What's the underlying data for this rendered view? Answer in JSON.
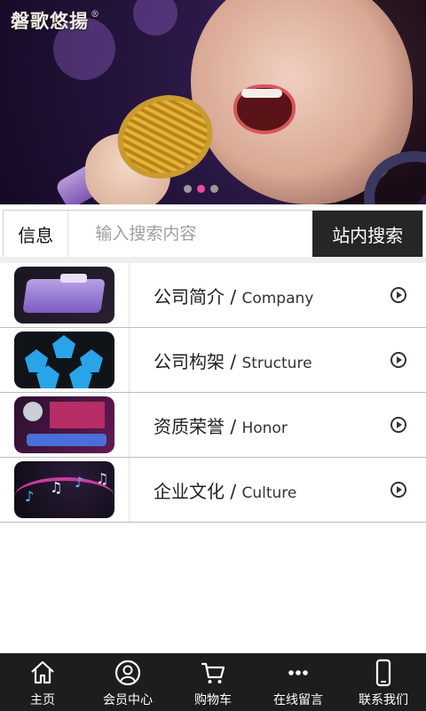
{
  "banner": {
    "logo_text": "磐歌悠揚",
    "logo_mark": "®",
    "slides": 3,
    "active_slide": 2
  },
  "search": {
    "category": "信息",
    "placeholder": "输入搜索内容",
    "button": "站内搜索"
  },
  "menu": [
    {
      "cn": "公司简介",
      "en": "Company"
    },
    {
      "cn": "公司构架",
      "en": "Structure"
    },
    {
      "cn": "资质荣誉",
      "en": "Honor"
    },
    {
      "cn": "企业文化",
      "en": "Culture"
    }
  ],
  "nav": [
    {
      "label": "主页",
      "icon": "home-icon"
    },
    {
      "label": "会员中心",
      "icon": "user-icon"
    },
    {
      "label": "购物车",
      "icon": "cart-icon"
    },
    {
      "label": "在线留言",
      "icon": "more-dots-icon"
    },
    {
      "label": "联系我们",
      "icon": "phone-icon"
    }
  ],
  "colors": {
    "accent_dot": "#e84ca0",
    "search_button": "#262626",
    "nav_bg": "#1d1d1d"
  }
}
